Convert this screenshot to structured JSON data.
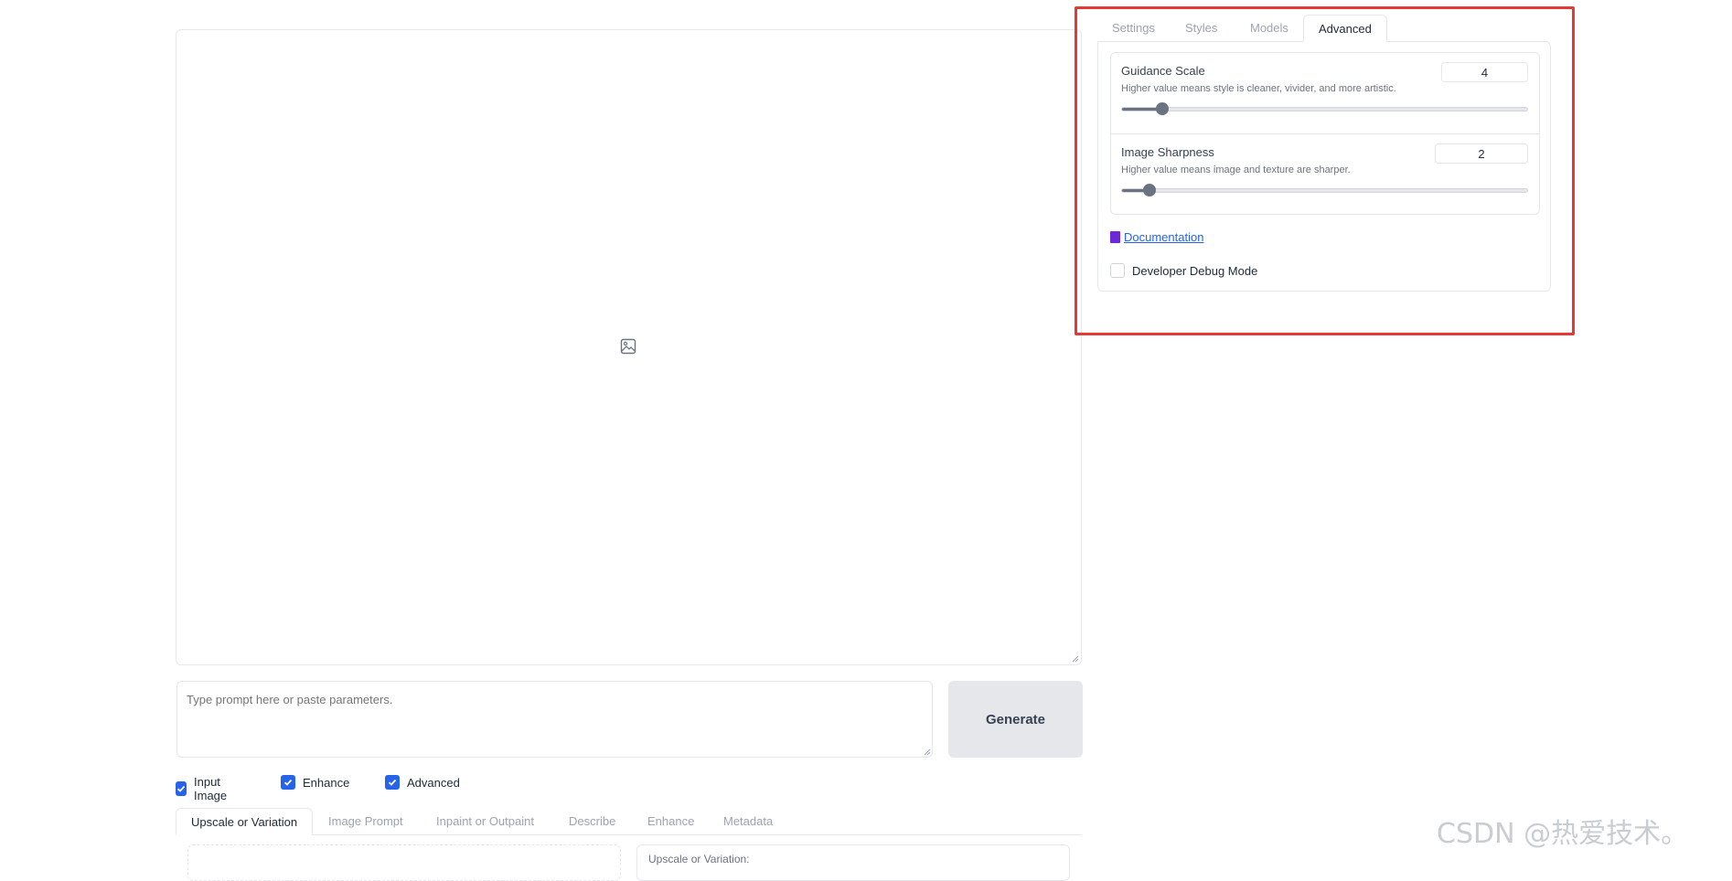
{
  "canvas": {
    "icon": "image-icon"
  },
  "prompt": {
    "placeholder": "Type prompt here or paste parameters.",
    "value": ""
  },
  "generate": {
    "label": "Generate"
  },
  "options": [
    {
      "label": "Input Image",
      "checked": true
    },
    {
      "label": "Enhance",
      "checked": true
    },
    {
      "label": "Advanced",
      "checked": true
    }
  ],
  "bottom_tabs": [
    {
      "label": "Upscale or Variation",
      "active": true
    },
    {
      "label": "Image Prompt",
      "active": false
    },
    {
      "label": "Inpaint or Outpaint",
      "active": false
    },
    {
      "label": "Describe",
      "active": false
    },
    {
      "label": "Enhance",
      "active": false
    },
    {
      "label": "Metadata",
      "active": false
    }
  ],
  "bottom_panel": {
    "right_label": "Upscale or Variation:"
  },
  "right_tabs": [
    {
      "label": "Settings",
      "active": false
    },
    {
      "label": "Styles",
      "active": false
    },
    {
      "label": "Models",
      "active": false
    },
    {
      "label": "Advanced",
      "active": true
    }
  ],
  "advanced": {
    "guidance": {
      "label": "Guidance Scale",
      "info": "Higher value means style is cleaner, vivider, and more artistic.",
      "value": "4",
      "fraction": 0.1
    },
    "sharpness": {
      "label": "Image Sharpness",
      "info": "Higher value means image and texture are sharper.",
      "value": "2",
      "fraction": 0.067
    },
    "documentation": {
      "label": "Documentation",
      "icon": "book-icon"
    },
    "debug": {
      "label": "Developer Debug Mode",
      "checked": false
    }
  },
  "highlight_color": "#e53935",
  "accent_color": "#2563eb",
  "watermark": "CSDN @热爱技术。"
}
